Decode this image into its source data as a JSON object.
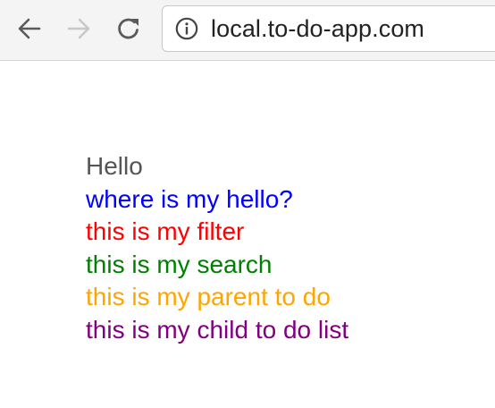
{
  "browser": {
    "icons": {
      "back": "arrow-left-icon",
      "forward": "arrow-right-icon",
      "reload": "reload-icon",
      "site_info": "info-circle-icon"
    },
    "address": "local.to-do-app.com"
  },
  "page": {
    "lines": [
      {
        "text": "Hello",
        "color": "#555555"
      },
      {
        "text": "where is my hello?",
        "color": "#0000ff"
      },
      {
        "text": "this is my filter",
        "color": "#ff0000"
      },
      {
        "text": "this is my search",
        "color": "#008000"
      },
      {
        "text": "this is my parent to do",
        "color": "#ffa500"
      },
      {
        "text": "this is my child to do list",
        "color": "#800080"
      }
    ]
  }
}
